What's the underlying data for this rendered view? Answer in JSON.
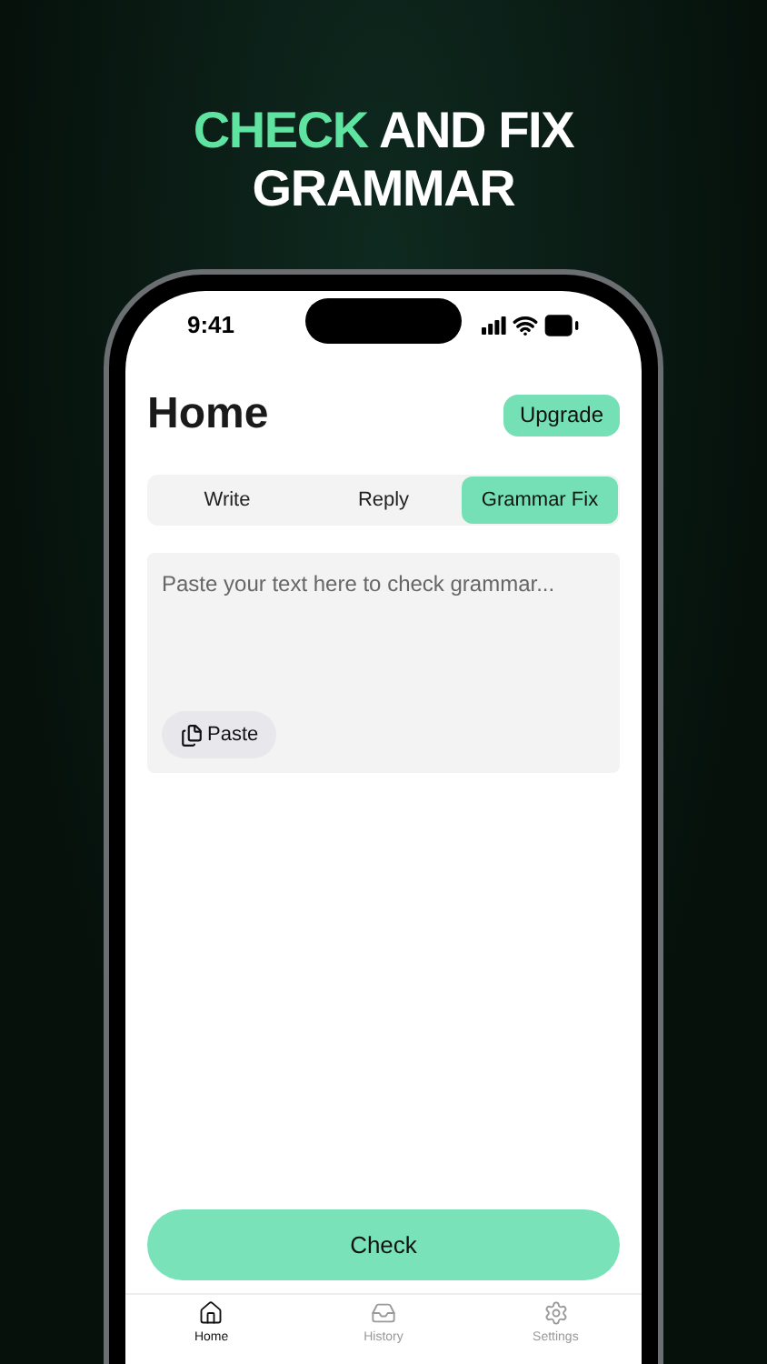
{
  "headline": {
    "highlight": "CHECK",
    "rest": "AND FIX GRAMMAR"
  },
  "status_bar": {
    "time": "9:41"
  },
  "header": {
    "title": "Home",
    "upgrade_button": "Upgrade"
  },
  "tabs": [
    {
      "label": "Write",
      "selected": false
    },
    {
      "label": "Reply",
      "selected": false
    },
    {
      "label": "Grammar Fix",
      "selected": true
    }
  ],
  "text_input": {
    "placeholder": "Paste your text here to check grammar...",
    "paste_button": "Paste"
  },
  "check_button": "Check",
  "tab_bar": [
    {
      "kind": "home",
      "label": "Home",
      "selected": true
    },
    {
      "kind": "history",
      "label": "History",
      "selected": false
    },
    {
      "kind": "settings",
      "label": "Settings",
      "selected": false
    }
  ]
}
